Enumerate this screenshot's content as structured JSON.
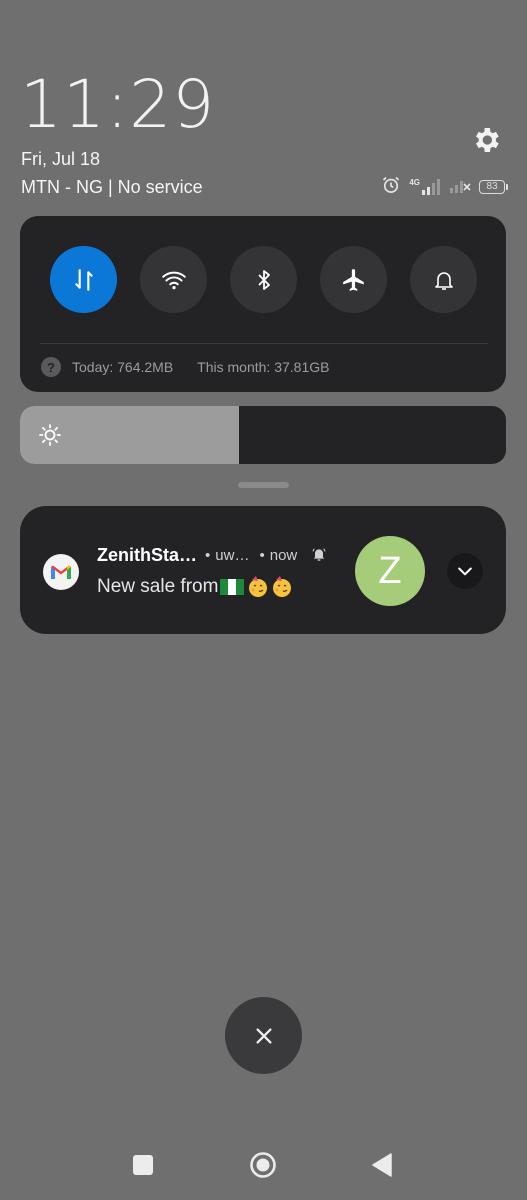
{
  "lockscreen": {
    "time": "11:29",
    "date": "Fri, Jul 18",
    "carrier": "MTN - NG | No service",
    "network_type": "4G",
    "battery_level": "83"
  },
  "quick_settings": {
    "toggles": [
      {
        "name": "mobile-data",
        "icon": "data-arrows-icon",
        "active": true
      },
      {
        "name": "wifi",
        "icon": "wifi-icon",
        "active": false
      },
      {
        "name": "bluetooth",
        "icon": "bluetooth-icon",
        "active": false
      },
      {
        "name": "airplane",
        "icon": "airplane-icon",
        "active": false
      },
      {
        "name": "sound",
        "icon": "bell-icon",
        "active": false
      }
    ],
    "data_today": "Today: 764.2MB",
    "data_month": "This month: 37.81GB",
    "help_glyph": "?"
  },
  "brightness": {
    "level": 0.45
  },
  "notification": {
    "app_icon": "gmail-icon",
    "title": "ZenithSta…",
    "account": "uw…",
    "time": "now",
    "bullet": "•",
    "text": "New sale from",
    "avatar_letter": "Z",
    "avatar_color": "#a4cc79"
  },
  "colors": {
    "accent": "#0b78d7",
    "background": "#6f6f6f",
    "panel": "#232325"
  }
}
